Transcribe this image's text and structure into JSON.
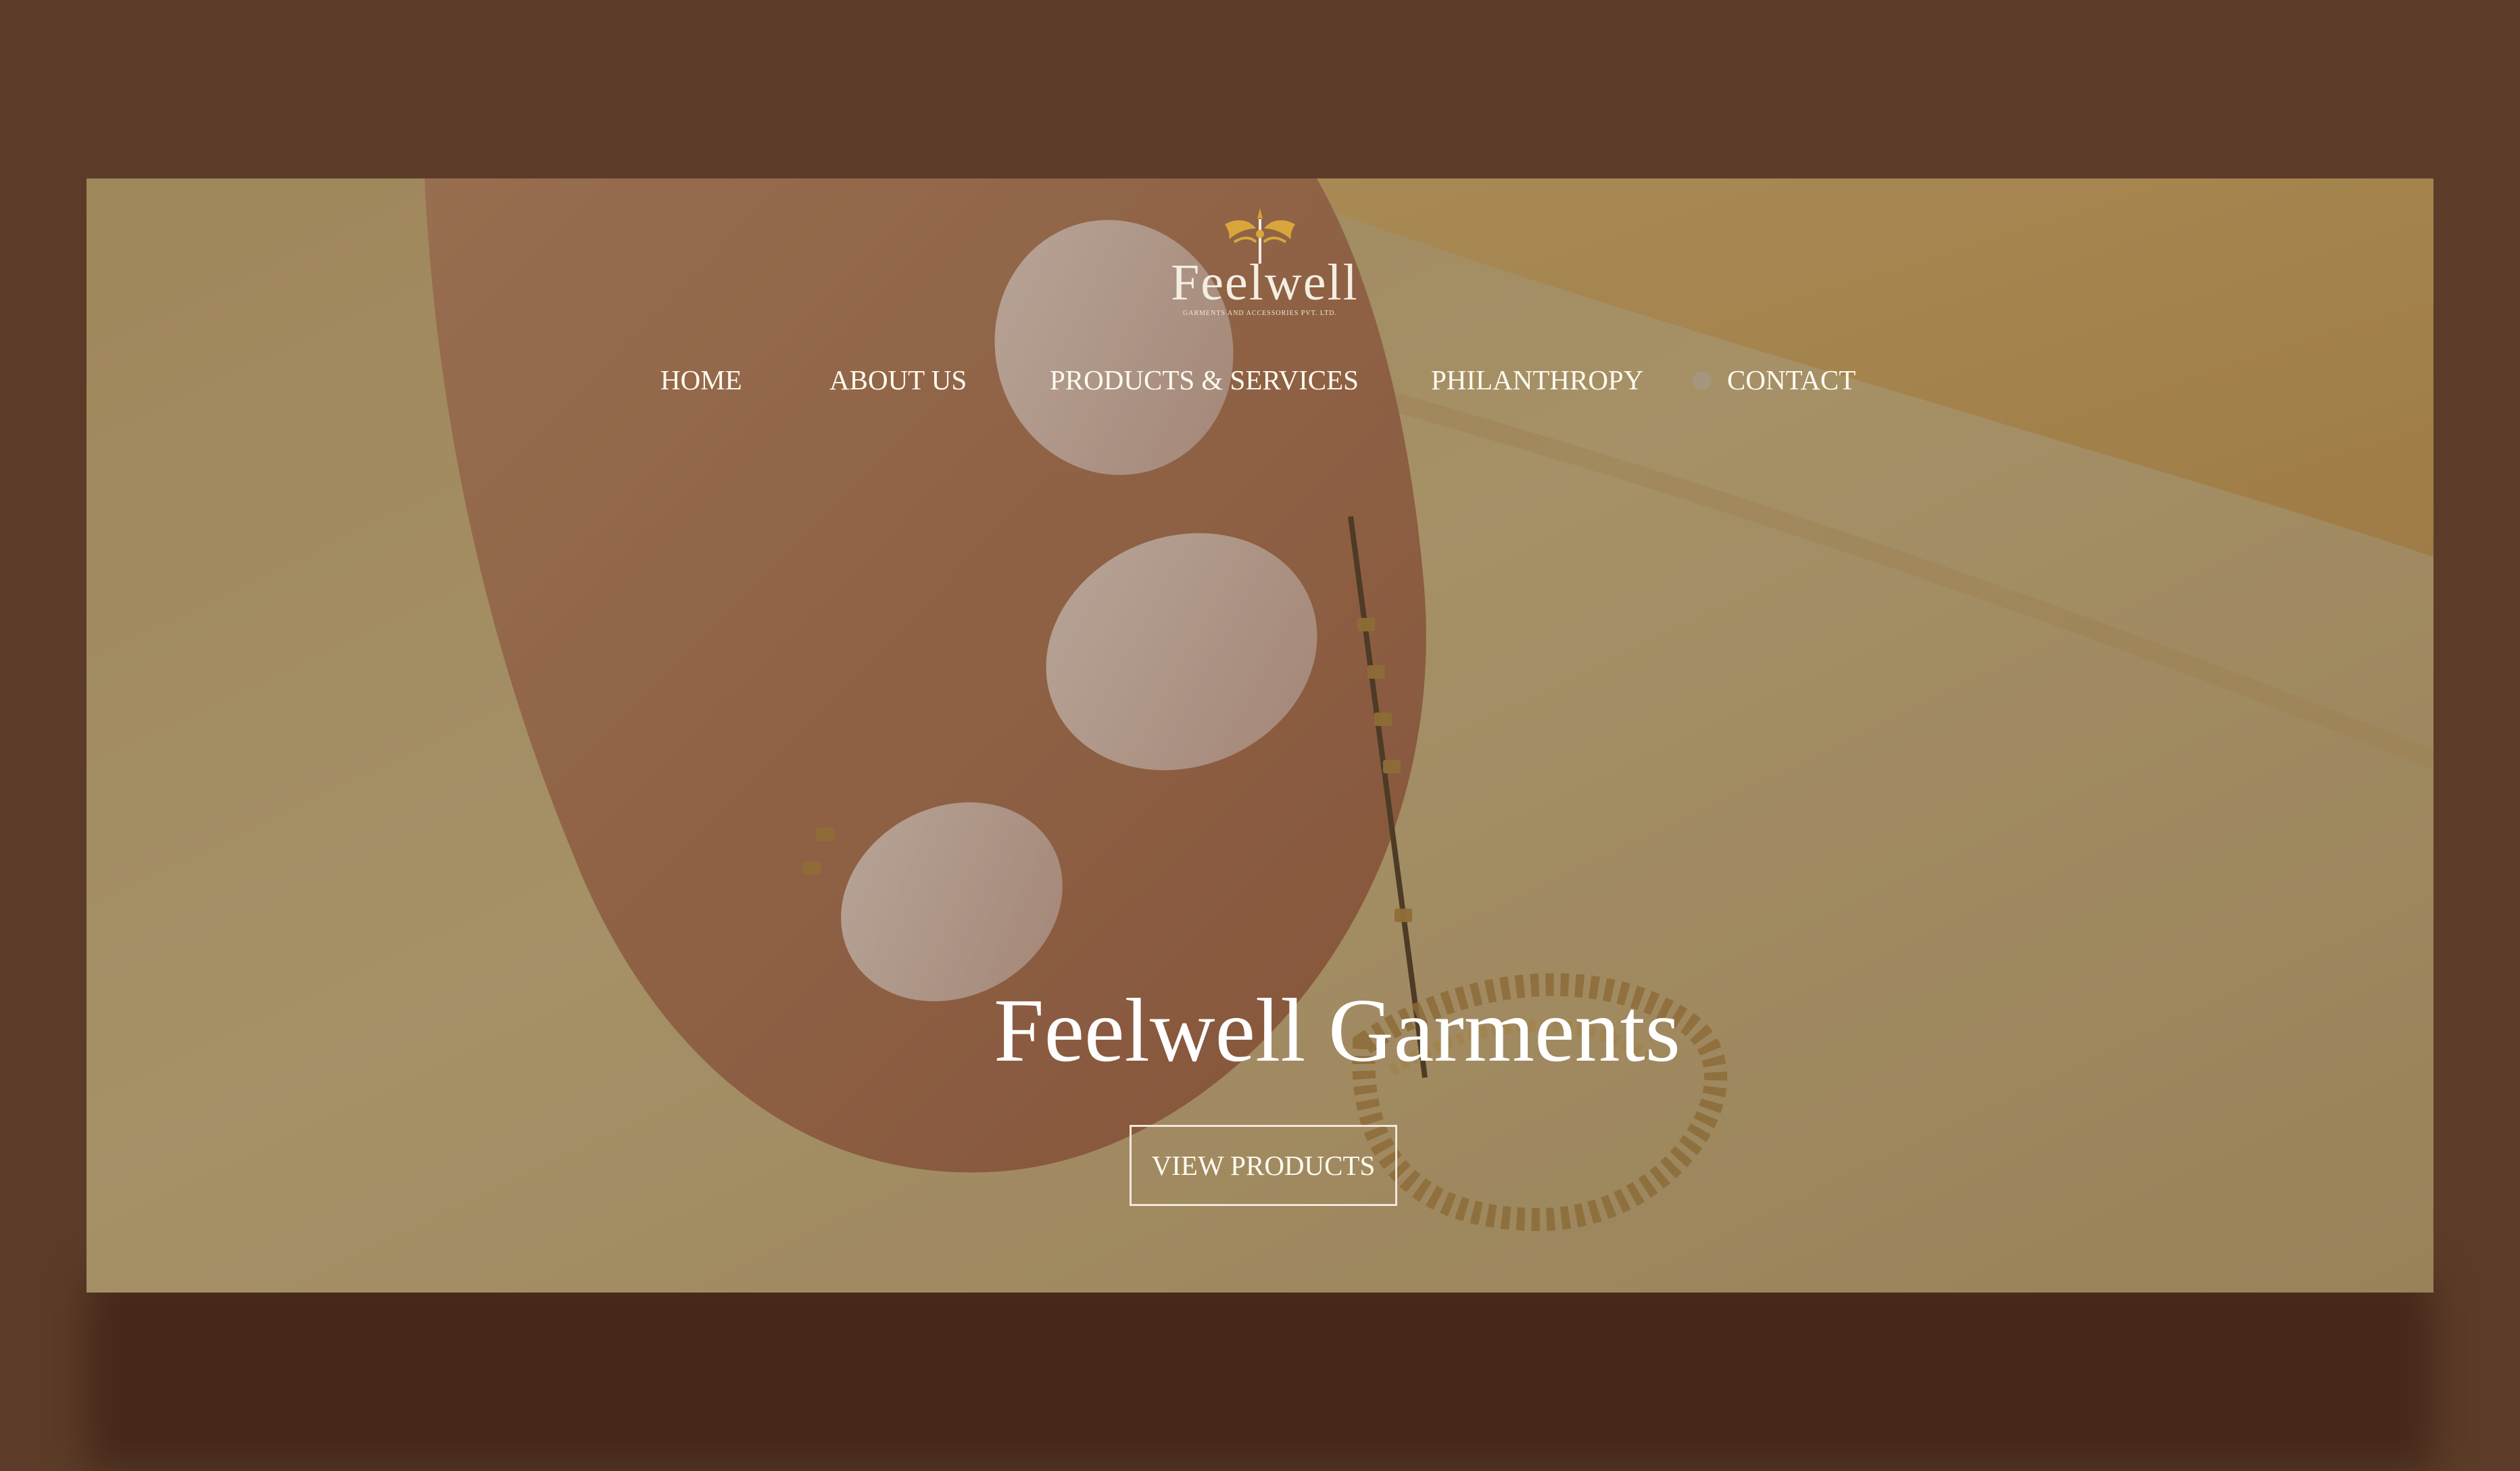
{
  "brand": {
    "logo_text": "Feelwell",
    "logo_subtitle": "GARMENTS AND ACCESSORIES PVT. LTD."
  },
  "nav": {
    "items": [
      {
        "label": "HOME"
      },
      {
        "label": "ABOUT US"
      },
      {
        "label": "PRODUCTS & SERVICES"
      },
      {
        "label": "PHILANTHROPY"
      },
      {
        "label": "CONTACT"
      }
    ]
  },
  "hero": {
    "title": "Feelwell Garments",
    "cta_label": "VIEW PRODUCTS"
  },
  "colors": {
    "backdrop": "#5c3c28",
    "accent_gold": "#d8a63a",
    "text_light": "#ffffff"
  }
}
